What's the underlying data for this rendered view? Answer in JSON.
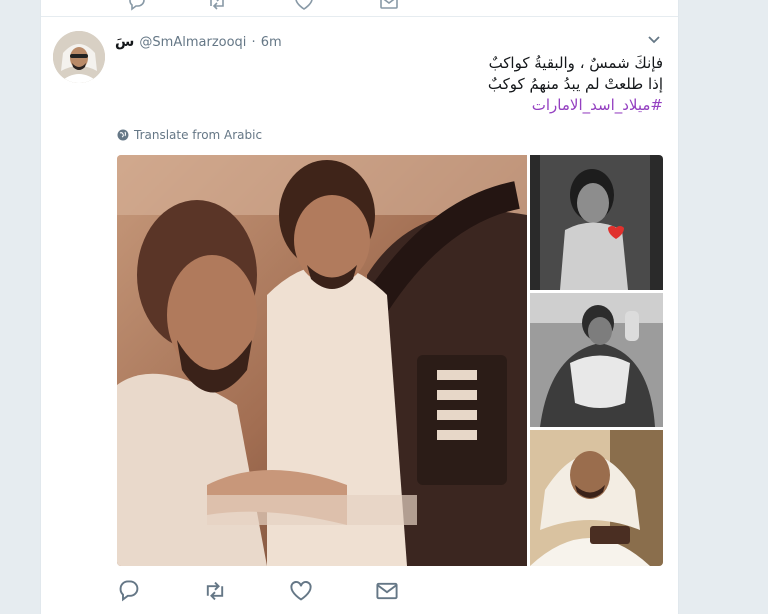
{
  "tweet": {
    "display_name": "سَ",
    "handle": "@SmAlmarzooqi",
    "separator": "·",
    "time": "6m",
    "text_line1": "فإنكَ شمسٌ ، والبقيةُ كواكبٌ",
    "text_line2": "إذا طلعتْ لم يبدُ منهمُ كوكبٌ",
    "hashtag": "#ميلاد_اسد_الامارات",
    "translate_label": "Translate from Arabic"
  },
  "actions": {
    "icons": [
      "reply-icon",
      "retweet-icon",
      "like-icon",
      "message-icon"
    ]
  },
  "colors": {
    "hashtag": "#9440c1",
    "icon": "#657786",
    "background": "#e6ecf0"
  }
}
